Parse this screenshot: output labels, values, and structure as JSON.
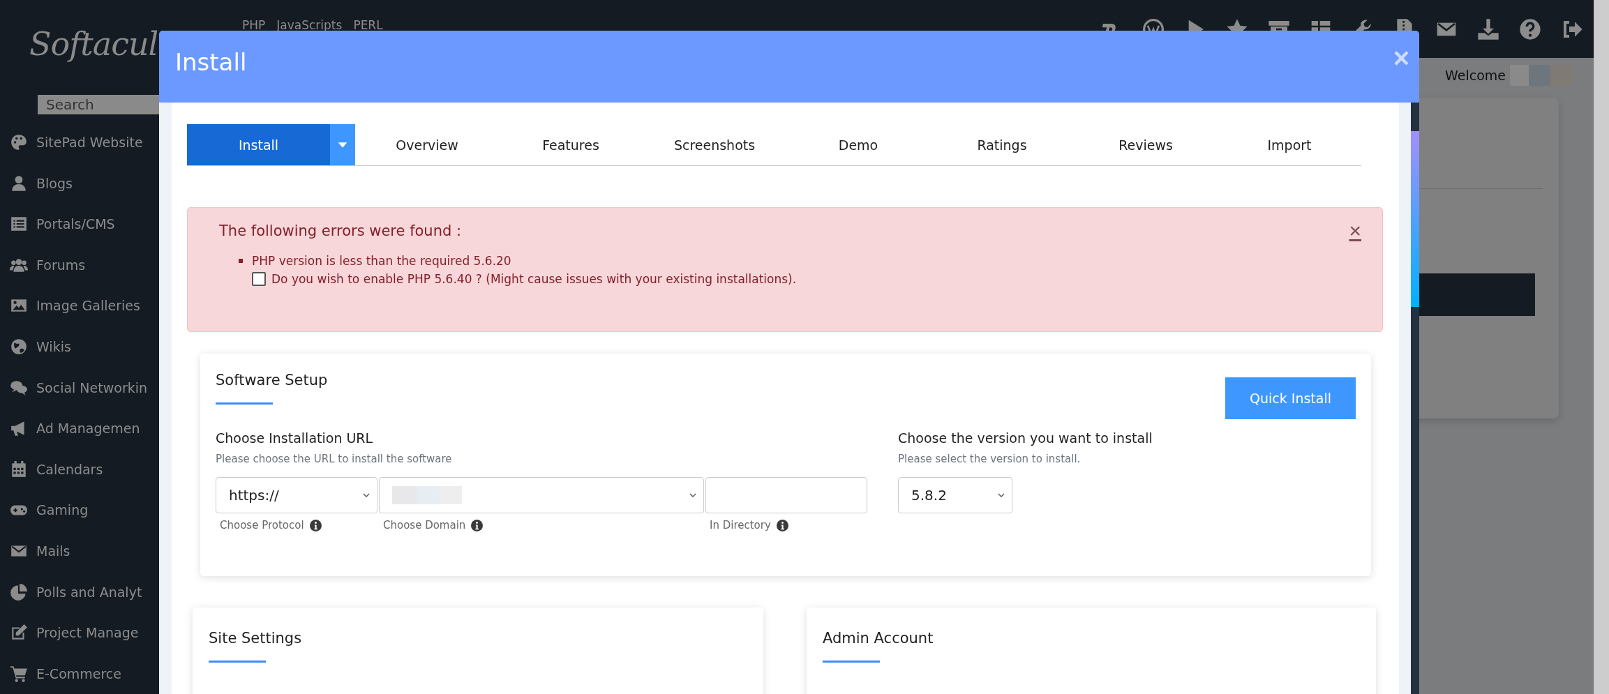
{
  "top_nav": {
    "logo": "Softacul",
    "links": [
      "PHP",
      "JavaScripts",
      "PERL"
    ]
  },
  "sidebar": {
    "search": {
      "placeholder": "Search"
    },
    "items": [
      {
        "label": "SitePad Website"
      },
      {
        "label": "Blogs"
      },
      {
        "label": "Portals/CMS"
      },
      {
        "label": "Forums"
      },
      {
        "label": "Image Galleries"
      },
      {
        "label": "Wikis"
      },
      {
        "label": "Social Networkin"
      },
      {
        "label": "Ad Managemen"
      },
      {
        "label": "Calendars"
      },
      {
        "label": "Gaming"
      },
      {
        "label": "Mails"
      },
      {
        "label": "Polls and Analyt"
      },
      {
        "label": "Project Manage"
      },
      {
        "label": "E-Commerce"
      }
    ]
  },
  "header": {
    "welcome": "Welcome"
  },
  "modal": {
    "title": "Install",
    "close": "×",
    "tabs": [
      {
        "label": "Install",
        "selected": true
      },
      {
        "label": "Overview",
        "selected": false
      },
      {
        "label": "Features",
        "selected": false
      },
      {
        "label": "Screenshots",
        "selected": false
      },
      {
        "label": "Demo",
        "selected": false
      },
      {
        "label": "Ratings",
        "selected": false
      },
      {
        "label": "Reviews",
        "selected": false
      },
      {
        "label": "Import",
        "selected": false
      }
    ],
    "alert": {
      "title": "The following errors were found :",
      "close": "×",
      "errors": [
        {
          "text": "PHP version is less than the required 5.6.20",
          "option": {
            "label": "Do you wish to enable PHP 5.6.40 ? (Might cause issues with your existing installations).",
            "checked": false
          }
        }
      ]
    },
    "software_setup": {
      "title": "Software Setup",
      "quick_install": "Quick Install",
      "url": {
        "label": "Choose Installation URL",
        "hint": "Please choose the URL to install the software",
        "protocol": {
          "value": "https://",
          "caption": "Choose Protocol"
        },
        "domain": {
          "caption": "Choose Domain"
        },
        "directory": {
          "caption": "In Directory"
        }
      },
      "version": {
        "label": "Choose the version you want to install",
        "hint": "Please select the version to install.",
        "value": "5.8.2"
      }
    },
    "sections": [
      {
        "title": "Site Settings"
      },
      {
        "title": "Admin Account"
      }
    ]
  }
}
